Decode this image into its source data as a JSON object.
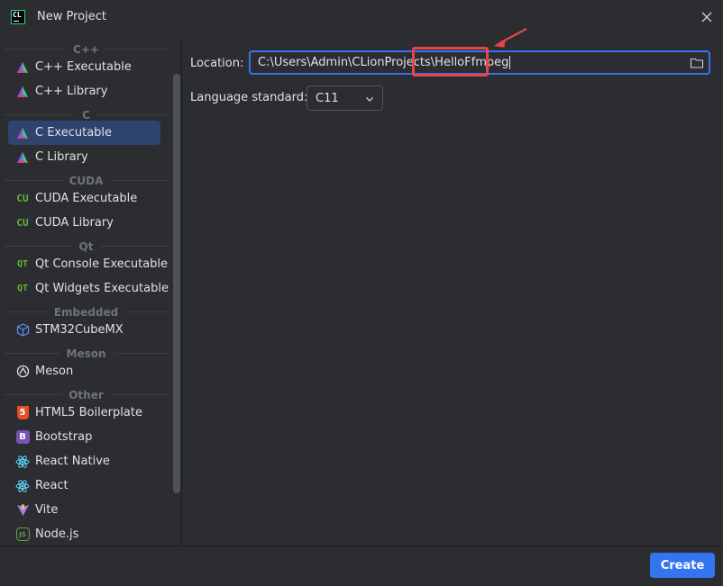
{
  "window": {
    "title": "New Project",
    "logo_text": "CL"
  },
  "sidebar": {
    "groups": [
      {
        "header": "C++",
        "items": [
          {
            "label": "C++ Executable",
            "icon": "clion-triangle-icon"
          },
          {
            "label": "C++ Library",
            "icon": "clion-triangle-icon"
          }
        ]
      },
      {
        "header": "C",
        "items": [
          {
            "label": "C Executable",
            "icon": "clion-triangle-icon",
            "selected": true
          },
          {
            "label": "C Library",
            "icon": "clion-triangle-icon"
          }
        ]
      },
      {
        "header": "CUDA",
        "items": [
          {
            "label": "CUDA Executable",
            "icon": "cuda-icon",
            "glyph": "CU"
          },
          {
            "label": "CUDA Library",
            "icon": "cuda-icon",
            "glyph": "CU"
          }
        ]
      },
      {
        "header": "Qt",
        "items": [
          {
            "label": "Qt Console Executable",
            "icon": "qt-icon",
            "glyph": "QT"
          },
          {
            "label": "Qt Widgets Executable",
            "icon": "qt-icon",
            "glyph": "QT"
          }
        ]
      },
      {
        "header": "Embedded",
        "items": [
          {
            "label": "STM32CubeMX",
            "icon": "cube-icon"
          }
        ]
      },
      {
        "header": "Meson",
        "items": [
          {
            "label": "Meson",
            "icon": "meson-icon"
          }
        ]
      },
      {
        "header": "Other",
        "items": [
          {
            "label": "HTML5 Boilerplate",
            "icon": "html5-icon",
            "glyph": "5"
          },
          {
            "label": "Bootstrap",
            "icon": "bootstrap-icon",
            "glyph": "B"
          },
          {
            "label": "React Native",
            "icon": "react-icon"
          },
          {
            "label": "React",
            "icon": "react-icon"
          },
          {
            "label": "Vite",
            "icon": "vite-icon"
          },
          {
            "label": "Node.js",
            "icon": "nodejs-icon",
            "glyph": "JS"
          }
        ]
      }
    ]
  },
  "form": {
    "location_label": "Location:",
    "location_value": "C:\\Users\\Admin\\CLionProjects\\HelloFfmpeg",
    "language_label": "Language standard:",
    "language_value": "C11"
  },
  "footer": {
    "create_label": "Create"
  },
  "colors": {
    "accent": "#3574f0",
    "selection": "#2e436e",
    "annotation": "#e8434a"
  }
}
